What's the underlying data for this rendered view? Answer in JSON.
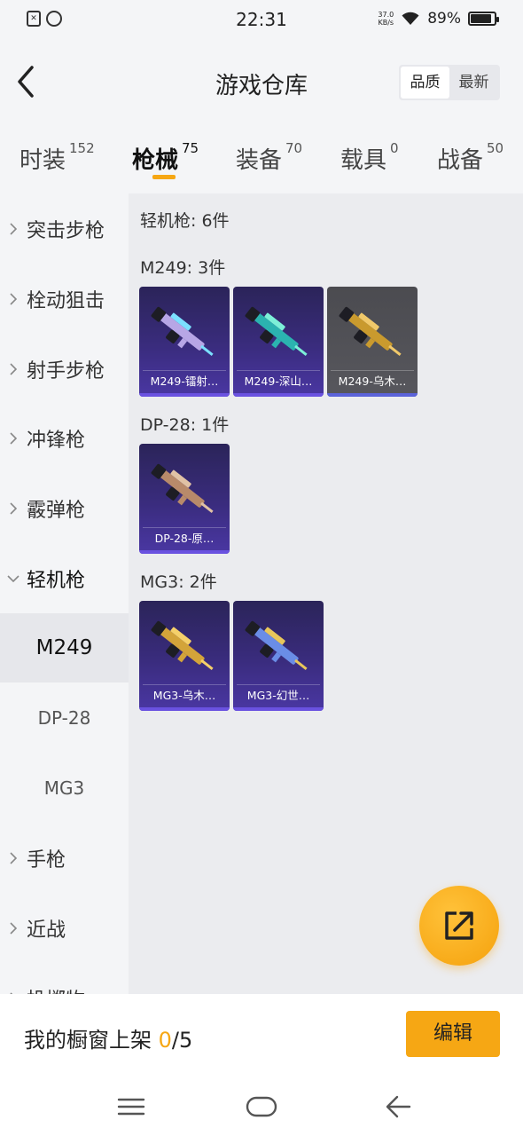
{
  "status_bar": {
    "time": "22:31",
    "speed_value": "37.0",
    "speed_unit": "KB/s",
    "battery": "89%",
    "battery_level": 0.89
  },
  "header": {
    "title": "游戏仓库",
    "sort": {
      "quality": "品质",
      "latest": "最新",
      "active": "quality"
    }
  },
  "tabs": [
    {
      "label": "时装",
      "count": "152"
    },
    {
      "label": "枪械",
      "count": "75",
      "active": true
    },
    {
      "label": "装备",
      "count": "70"
    },
    {
      "label": "载具",
      "count": "0"
    },
    {
      "label": "战备",
      "count": "50"
    }
  ],
  "sidebar": {
    "items": [
      {
        "label": "突击步枪"
      },
      {
        "label": "栓动狙击"
      },
      {
        "label": "射手步枪"
      },
      {
        "label": "冲锋枪"
      },
      {
        "label": "霰弹枪"
      },
      {
        "label": "轻机枪",
        "expanded": true
      },
      {
        "label": "手枪"
      },
      {
        "label": "近战"
      },
      {
        "label": "投掷物"
      }
    ],
    "subitems": [
      {
        "label": "M249",
        "selected": true
      },
      {
        "label": "DP-28"
      },
      {
        "label": "MG3"
      }
    ]
  },
  "content": {
    "category_title": "轻机枪: 6件",
    "groups": [
      {
        "title": "M249: 3件",
        "items": [
          {
            "label": "M249-镭射…",
            "gun_color": "#b7a6e6",
            "accent": "#7be0ff"
          },
          {
            "label": "M249-深山…",
            "gun_color": "#2bb3b0",
            "accent": "#7cf0d8"
          },
          {
            "label": "M249-乌木…",
            "gun_color": "#c99a2e",
            "accent": "#f1c96a",
            "grey": true
          }
        ]
      },
      {
        "title": "DP-28: 1件",
        "items": [
          {
            "label": "DP-28-原…",
            "gun_color": "#b88a6a",
            "accent": "#e0c2a5"
          }
        ]
      },
      {
        "title": "MG3: 2件",
        "items": [
          {
            "label": "MG3-乌木…",
            "gun_color": "#d3a43a",
            "accent": "#f5d06a"
          },
          {
            "label": "MG3-幻世…",
            "gun_color": "#6a8de6",
            "accent": "#e8c65a"
          }
        ]
      }
    ]
  },
  "showcase": {
    "label": "我的橱窗上架",
    "current": "0",
    "separator": "/",
    "max": "5"
  },
  "edit_button": "编辑",
  "colors": {
    "accent": "#f6a714",
    "card_purple": "#3a2c7e",
    "card_grey": "#55555b"
  },
  "icons": {
    "back": "back-chevron-icon",
    "fab": "share-external-icon",
    "nav_menu": "menu-icon",
    "nav_home": "home-icon",
    "nav_back": "back-arrow-icon"
  }
}
